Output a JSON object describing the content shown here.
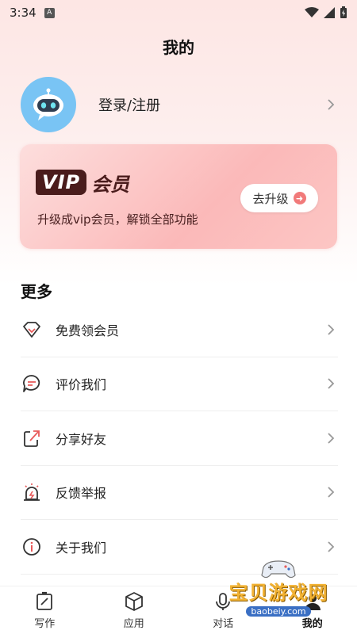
{
  "status_bar": {
    "time": "3:34",
    "notif_letter": "A"
  },
  "header": {
    "title": "我的"
  },
  "profile": {
    "login_label": "登录/注册"
  },
  "vip": {
    "badge": "VIP",
    "badge_suffix": "会员",
    "description": "升级成vip会员，解锁全部功能",
    "upgrade_label": "去升级"
  },
  "more": {
    "title": "更多",
    "items": [
      {
        "label": "免费领会员",
        "icon": "diamond-icon"
      },
      {
        "label": "评价我们",
        "icon": "comment-icon"
      },
      {
        "label": "分享好友",
        "icon": "share-icon"
      },
      {
        "label": "反馈举报",
        "icon": "alarm-icon"
      },
      {
        "label": "关于我们",
        "icon": "info-icon"
      }
    ]
  },
  "tabbar": {
    "tabs": [
      {
        "label": "写作",
        "icon": "edit-icon"
      },
      {
        "label": "应用",
        "icon": "cube-icon"
      },
      {
        "label": "对话",
        "icon": "mic-icon"
      },
      {
        "label": "我的",
        "icon": "profile-icon",
        "active": true
      }
    ]
  },
  "watermark": {
    "text": "宝贝游戏网",
    "url": "baobeiy.com"
  },
  "colors": {
    "accent": "#f17a7a",
    "vip_dark": "#4a1c1c",
    "avatar_bg": "#79c4f4"
  }
}
